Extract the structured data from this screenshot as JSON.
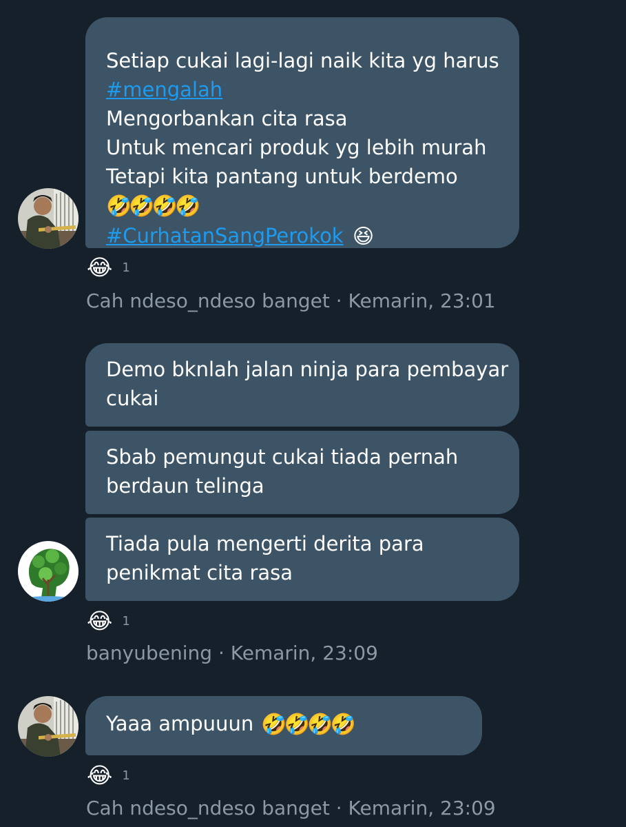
{
  "messages": [
    {
      "author": "Cah ndeso_ndeso banget",
      "time": "Kemarin, 23:01",
      "bubble_lines": [
        "Setiap cukai lagi-lagi naik kita yg harus",
        "#mengalah",
        "Mengorbankan cita rasa",
        "Untuk mencari produk yg lebih murah",
        "Tetapi kita pantang untuk berdemo",
        "🤣🤣🤣🤣",
        "#CurhatanSangPerokok"
      ],
      "trailing_emoji": "😆",
      "reaction": {
        "emoji": "😂",
        "count": "1"
      }
    },
    {
      "author": "banyubening",
      "time": "Kemarin, 23:09",
      "bubbles": [
        {
          "lines": [
            "Demo bknlah jalan ninja para pembayar",
            "cukai"
          ]
        },
        {
          "lines": [
            "Sbab pemungut cukai tiada pernah",
            "berdaun telinga"
          ]
        },
        {
          "lines": [
            "Tiada pula mengerti derita para",
            "penikmat cita rasa"
          ]
        }
      ],
      "reaction": {
        "emoji": "😂",
        "count": "1"
      }
    },
    {
      "author": "Cah ndeso_ndeso banget",
      "time": "Kemarin, 23:09",
      "text": "Yaaa ampuuun",
      "emojis": "🤣🤣🤣🤣",
      "reaction": {
        "emoji": "😂",
        "count": "1"
      }
    }
  ],
  "separator": " · "
}
